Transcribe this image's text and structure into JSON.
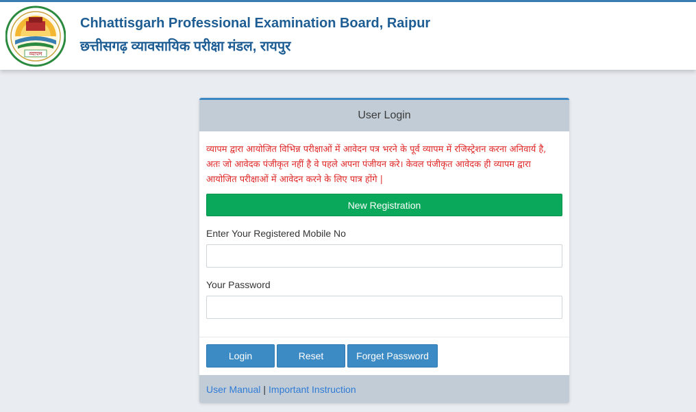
{
  "header": {
    "title_en": "Chhattisgarh Professional Examination Board, Raipur",
    "title_hi": "छत्तीसगढ़ व्यावसायिक परीक्षा मंडल, रायपुर",
    "logo_text": "व्यापम",
    "logo_icon": "vyapam-logo-icon"
  },
  "login_card": {
    "title": "User Login",
    "notice": "व्यापम द्वारा आयोजित विभिन्न  परीक्षाओं में आवेदन पत्र भरने के पूर्व व्यापम में रजिस्ट्रेशन करना अनिवार्य है, अतः जो आवेदक पंजीकृत नहीं है वे पहले अपना  पंजीयन करे।  केवल पंजीकृत आवेदक ही व्यापम द्वारा आयोजित परीक्षाओं में आवेदन करने के लिए पात्र होंगे |",
    "new_registration_label": "New Registration",
    "mobile_label": "Enter Your Registered Mobile No",
    "mobile_value": "",
    "password_label": "Your Password",
    "password_value": "",
    "buttons": {
      "login": "Login",
      "reset": "Reset",
      "forget": "Forget Password"
    },
    "footer": {
      "user_manual": "User Manual",
      "separator": "|",
      "important_instruction": "Important Instruction"
    }
  },
  "colors": {
    "brand_blue": "#1d5d94",
    "accent_blue": "#3d8bc4",
    "success_green": "#0aa85a",
    "notice_red": "#e02626",
    "panel_gray": "#c1ccd6",
    "link_blue": "#2f7bd6"
  }
}
